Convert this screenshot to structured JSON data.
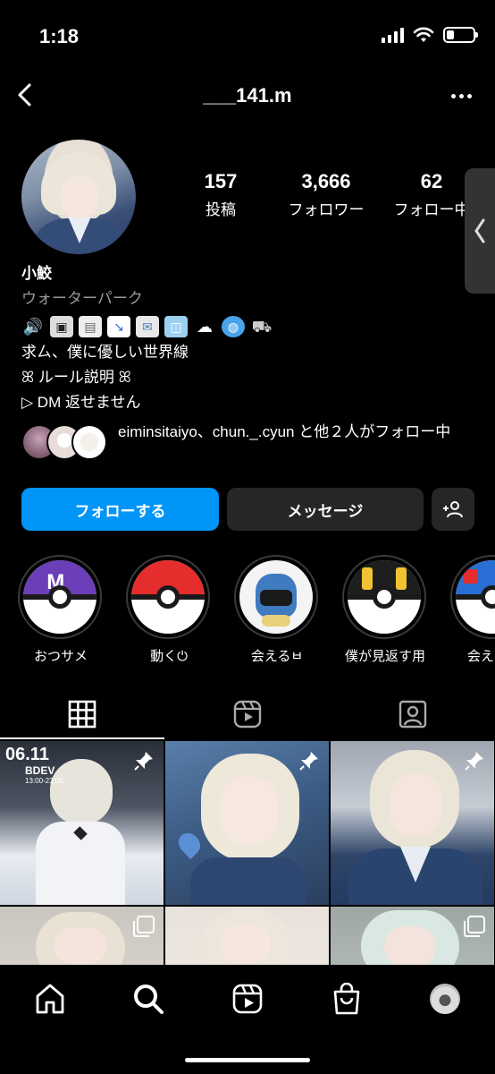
{
  "status": {
    "time": "1:18"
  },
  "header": {
    "username": "___141.m"
  },
  "stats": [
    {
      "value": "157",
      "label": "投稿"
    },
    {
      "value": "3,666",
      "label": "フォロワー"
    },
    {
      "value": "62",
      "label": "フォロー中"
    }
  ],
  "bio": {
    "name": "小鮫",
    "category": "ウォーターパーク",
    "emojis": [
      "speaker",
      "floppy",
      "page",
      "chart-down",
      "envelope",
      "ice",
      "rain-cloud",
      "globe",
      "cart"
    ],
    "lines": [
      "求ㄙ、僕に優しい世界線",
      "ꕤ ルール説明 ꕤ",
      "▷ DM 返せません"
    ]
  },
  "followed_by": {
    "text": "eiminsitaiyo、chun._.cyun と他２人がフォロー中"
  },
  "buttons": {
    "follow": "フォローする",
    "message": "メッセージ"
  },
  "highlights": [
    {
      "label": "おつサメ",
      "type": "master-ball"
    },
    {
      "label": "動く⏻",
      "type": "poke-ball"
    },
    {
      "label": "会えるㅂ",
      "type": "photo"
    },
    {
      "label": "僕が見返す用",
      "type": "ultra-ball"
    },
    {
      "label": "会えるㅂ",
      "type": "great-ball"
    }
  ],
  "grid_posts": [
    {
      "pinned": true,
      "date": "06.11",
      "sub": "BDEV",
      "time": "13:00-23:00"
    },
    {
      "pinned": true
    },
    {
      "pinned": true
    },
    {
      "multi": true
    },
    {
      "multi": false
    },
    {
      "multi": true
    }
  ],
  "colors": {
    "accent": "#0095f6",
    "button_dark": "#262626",
    "background": "#000000"
  }
}
